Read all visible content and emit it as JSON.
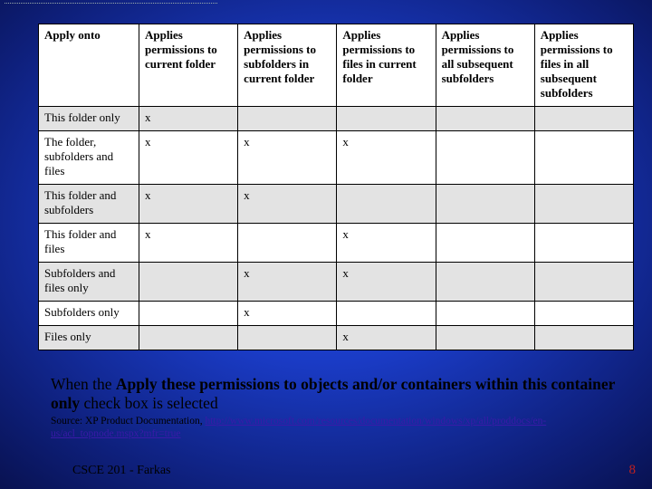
{
  "table": {
    "headers": [
      "Apply onto",
      "Applies permissions to current folder",
      "Applies permissions to subfolders in current folder",
      "Applies permissions to files in current folder",
      "Applies permissions to all subsequent subfolders",
      "Applies permissions to files in all subsequent subfolders"
    ],
    "rows": [
      {
        "label": "This folder only",
        "cells": [
          "x",
          "",
          "",
          "",
          ""
        ]
      },
      {
        "label": "The folder, subfolders and files",
        "cells": [
          "x",
          "x",
          "x",
          "",
          ""
        ]
      },
      {
        "label": "This folder and subfolders",
        "cells": [
          "x",
          "x",
          "",
          "",
          ""
        ]
      },
      {
        "label": "This folder and files",
        "cells": [
          "x",
          "",
          "x",
          "",
          ""
        ]
      },
      {
        "label": "Subfolders and files only",
        "cells": [
          "",
          "x",
          "x",
          "",
          ""
        ]
      },
      {
        "label": "Subfolders only",
        "cells": [
          "",
          "x",
          "",
          "",
          ""
        ]
      },
      {
        "label": "Files only",
        "cells": [
          "",
          "",
          "x",
          "",
          ""
        ]
      }
    ]
  },
  "body": {
    "pre": "When the ",
    "bold": "Apply these permissions to objects and/or containers within this container only",
    "post": " check box is selected"
  },
  "source": {
    "prefix": "Source: XP Product Documentation, ",
    "url": "http://www.microsoft.com/resources/documentation/windows/xp/all/proddocs/en-us/acl_topnode.mspx?mfr=true"
  },
  "footer": {
    "left": "CSCE 201 - Farkas",
    "right": "8"
  }
}
